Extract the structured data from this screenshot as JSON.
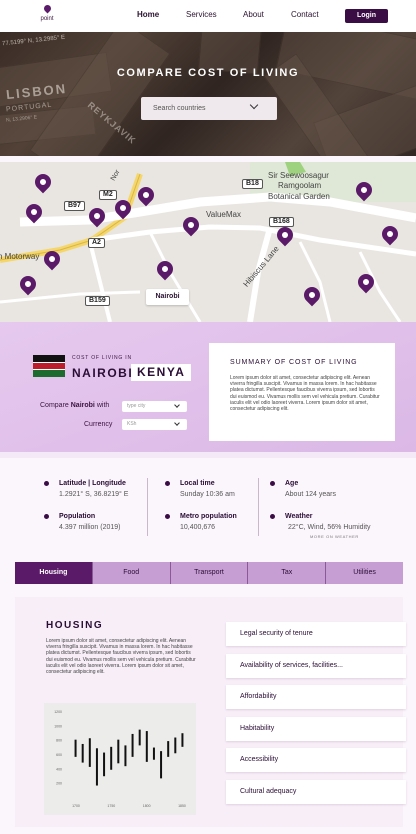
{
  "nav": {
    "logo_text": "PIN",
    "logo_sub": "point",
    "links": [
      "Home",
      "Services",
      "About",
      "Contact"
    ],
    "login": "Login"
  },
  "hero": {
    "title": "COMPARE COST OF LIVING",
    "search_placeholder": "Search countries",
    "backdrop_text": [
      "LISBON",
      "PORTUGAL",
      "N, 13.2906° E",
      "77.5199° N, 13.2985° E",
      "REYKJAVIK"
    ]
  },
  "map": {
    "labels": [
      "Sir Seewoosagur",
      "Ramgoolam",
      "Botanical Garden",
      "ValueMax",
      "Hibiscus Lane",
      "h Motorway"
    ],
    "road_signs": [
      "B18",
      "M2",
      "B97",
      "B168",
      "A2",
      "B159"
    ],
    "popup": "Nairobi",
    "colors": {
      "marker": "#5b1a68",
      "motorway": "#f5d66a"
    }
  },
  "cost": {
    "subtitle": "COST OF LIVING IN",
    "city": "NAIROBI,",
    "country": "KENYA",
    "compare_label_prefix": "Compare",
    "compare_label_city": "Nairobi",
    "compare_label_suffix": "with",
    "compare_placeholder": "type city",
    "currency_label": "Currency",
    "currency_value": "KSh",
    "summary_title": "SUMMARY OF COST OF LIVING",
    "summary_text": "Lorem ipsum dolor sit amet, consectetur adipiscing elit. Aenean viverra fringilla suscipit. Vivamus in massa lorem. In hac habitasse platea dictumst. Pellentesque faucibus viverra ipsum, sed lobortis dui euismod eu. Vivamus mollis sem vel vehicula pretium. Curabitur iaculis elit vel odio laoreet viverra. Lorem ipsum dolor sit amet, consectetur adipiscing elit."
  },
  "stats": {
    "latlong_label": "Latitude | Longitude",
    "latlong_value": "1.2921° S, 36.8219° E",
    "population_label": "Population",
    "population_value": "4.397 million (2019)",
    "localtime_label": "Local time",
    "localtime_value": "Sunday 10:36 am",
    "metro_label": "Metro population",
    "metro_value": "10,400,676",
    "age_label": "Age",
    "age_value": "About 124 years",
    "weather_label": "Weather",
    "weather_value": "22°C, Wind, 56% Humidity",
    "more_weather": "MORE ON WEATHER"
  },
  "tabs": [
    "Housing",
    "Food",
    "Transport",
    "Tax",
    "Utilities"
  ],
  "active_tab": "Housing",
  "housing": {
    "title": "HOUSING",
    "text": "Lorem ipsum dolor sit amet, consectetur adipiscing elit. Aenean viverra fringilla suscipit. Vivamus in massa lorem. In hac habitasse platea dictumst. Pellentesque faucibus viverra ipsum, sed lobortis dui euismod eu. Vivamus mollis sem vel vehicula pretium. Curabitur iaculis elit vel odio laoreet viverra. Lorem ipsum dolor sit amet, consectetur adipiscing elit.",
    "criteria": [
      "Legal security of tenure",
      "Availability of services, facilities...",
      "Affordability",
      "Habitability",
      "Accessibility",
      "Cultural adequacy"
    ]
  },
  "colors": {
    "brand_dark": "#3a0e45",
    "brand": "#5b1a68",
    "tab_inactive": "#c79ed4",
    "section_bg": "#dbb8e6"
  },
  "chart_data": {
    "type": "bar",
    "title": "",
    "xlabel": "",
    "ylabel": "",
    "ylim": [
      0,
      1200
    ],
    "yticks": [
      "200",
      "400",
      "600",
      "800",
      "1000",
      "1200"
    ],
    "xticks": [
      "1700",
      "1750",
      "1800",
      "1850"
    ],
    "series": [
      {
        "values": [
          [
            560,
            800
          ],
          [
            480,
            740
          ],
          [
            420,
            820
          ],
          [
            160,
            680
          ],
          [
            290,
            620
          ],
          [
            380,
            700
          ],
          [
            470,
            800
          ],
          [
            430,
            720
          ],
          [
            560,
            880
          ],
          [
            720,
            940
          ],
          [
            490,
            920
          ],
          [
            520,
            690
          ],
          [
            260,
            640
          ],
          [
            560,
            780
          ],
          [
            610,
            830
          ],
          [
            700,
            890
          ]
        ]
      }
    ]
  }
}
